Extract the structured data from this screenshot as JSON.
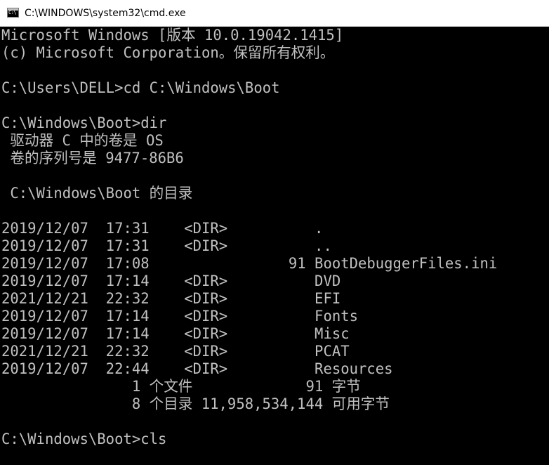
{
  "window": {
    "title": "C:\\WINDOWS\\system32\\cmd.exe",
    "icon": "cmd-console-icon",
    "icon_text": "C:\\"
  },
  "colors": {
    "console_background": "#000000",
    "console_text": "#c0c0c0",
    "titlebar_background": "#ffffff"
  },
  "console": {
    "lines": [
      "Microsoft Windows [版本 10.0.19042.1415]",
      "(c) Microsoft Corporation。保留所有权利。",
      "",
      "C:\\Users\\DELL>cd C:\\Windows\\Boot",
      "",
      "C:\\Windows\\Boot>dir",
      " 驱动器 C 中的卷是 OS",
      " 卷的序列号是 9477-86B6",
      "",
      " C:\\Windows\\Boot 的目录",
      "",
      "2019/12/07  17:31    <DIR>          .",
      "2019/12/07  17:31    <DIR>          ..",
      "2019/12/07  17:08                91 BootDebuggerFiles.ini",
      "2019/12/07  17:14    <DIR>          DVD",
      "2021/12/21  22:32    <DIR>          EFI",
      "2019/12/07  17:14    <DIR>          Fonts",
      "2019/12/07  17:14    <DIR>          Misc",
      "2021/12/21  22:32    <DIR>          PCAT",
      "2019/12/07  22:44    <DIR>          Resources",
      "               1 个文件             91 字节",
      "               8 个目录 11,958,534,144 可用字节",
      "",
      "C:\\Windows\\Boot>cls"
    ]
  }
}
